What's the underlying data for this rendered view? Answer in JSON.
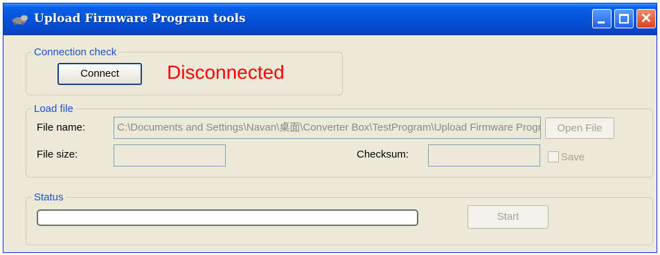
{
  "window": {
    "title": "Upload Firmware Program tools",
    "accent": "#0553d8"
  },
  "title_icon": "app-icon",
  "title_buttons": {
    "minimize": "minimize-icon",
    "maximize": "maximize-icon",
    "close": "close-icon"
  },
  "connection": {
    "legend": "Connection check",
    "connect_label": "Connect",
    "status": "Disconnected",
    "status_color": "#ff0000"
  },
  "load_file": {
    "legend": "Load file",
    "file_name_label": "File name:",
    "file_name_value": "C:\\Documents and Settings\\Navan\\桌面\\Converter Box\\TestProgram\\Upload Firmware Program",
    "open_file_label": "Open File",
    "file_size_label": "File size:",
    "file_size_value": "",
    "checksum_label": "Checksum:",
    "checksum_value": "",
    "save_label": "Save"
  },
  "status": {
    "legend": "Status",
    "progress_percent": 0,
    "start_label": "Start"
  }
}
